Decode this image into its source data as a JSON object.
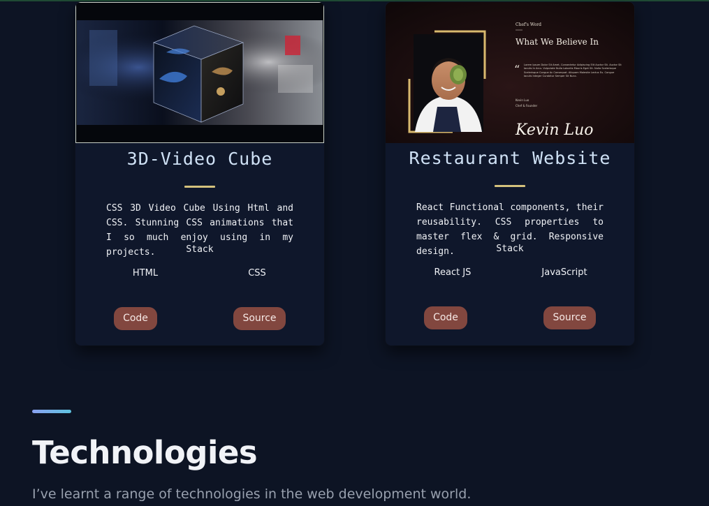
{
  "projects": [
    {
      "title": "3D-Video Cube",
      "description": "CSS 3D Video Cube Using Html and CSS. Stunning CSS animations that I so much enjoy using in my projects.",
      "stack_label": "Stack",
      "stack": [
        "HTML",
        "CSS"
      ],
      "code_label": "Code",
      "source_label": "Source",
      "thumbnail_icon": "video-cube-thumbnail"
    },
    {
      "title": "Restaurant Website",
      "description": "React Functional components, their reusability. CSS properties to master flex & grid. Responsive design.",
      "stack_label": "Stack",
      "stack": [
        "React JS",
        "JavaScript"
      ],
      "code_label": "Code",
      "source_label": "Source",
      "thumbnail_icon": "restaurant-thumbnail",
      "thumbnail": {
        "kicker": "Chef's Word",
        "heading": "What We Believe In",
        "quote_mark": "“",
        "body": "Lorem Ipsum Dolor Sit Amet, Consectetur Adipiscing Elit Auctor Sit. Auctor Sit Iaculis In Arcu. Vulputate Nulla Lobortis Mauris Eget Sit. Nulla Scelerisque Scelerisque Congue Ac Consequat. Aliquam Molestie Lectus Eu. Congue Iaculis Integer Curabitur Semper Sit Nunc.",
        "author": "Kevin Luo",
        "role": "Chef & Founder",
        "signature": "Kevin Luo"
      }
    }
  ],
  "technologies": {
    "title": "Technologies",
    "subtitle": "I’ve learnt a range of technologies in the web development world."
  },
  "colors": {
    "background": "#0d1424",
    "card": "#0f172b",
    "title_blue": "#cfe1f5",
    "underline_gold": "#d4c17c",
    "button": "#82473f",
    "accent_start": "#8aa1f0",
    "accent_end": "#5fc3e0"
  }
}
